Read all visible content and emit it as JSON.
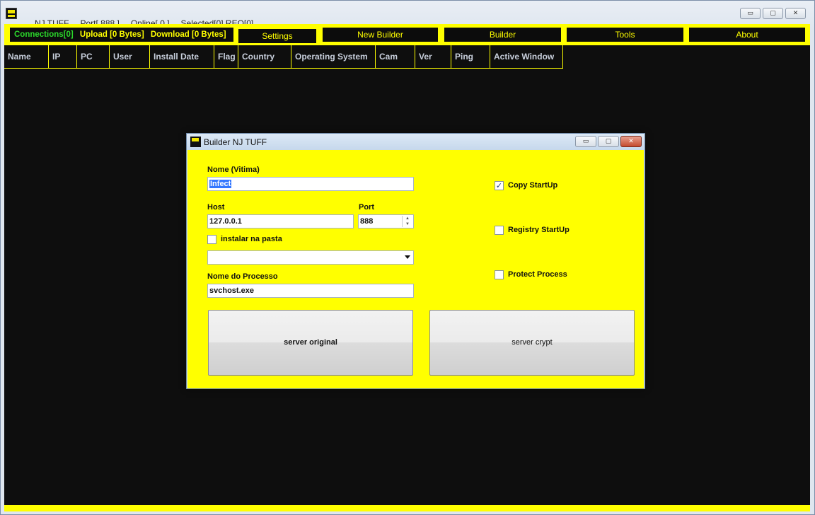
{
  "window": {
    "app_name": "NJ TUFF",
    "port": "Port[ 888 ]",
    "online": "Online[ 0 ]",
    "selected": "Selected[0] REQ[0]",
    "controls": {
      "minimize": "▭",
      "maximize": "▢",
      "close": "✕"
    }
  },
  "toolbar": {
    "connections": "Connections[0]",
    "upload": "Upload [0 Bytes]",
    "download": "Download [0 Bytes]",
    "buttons": [
      "Settings",
      "New Builder",
      "Builder",
      "Tools",
      "About"
    ],
    "colors": {
      "bar": "#ffff00",
      "button_bg": "#0c0c0c",
      "connections_text": "#2bd62b"
    }
  },
  "table": {
    "columns": [
      "Name",
      "IP",
      "PC",
      "User",
      "Install Date",
      "Flag",
      "Country",
      "Operating System",
      "Cam",
      "Ver",
      "Ping",
      "Active Window"
    ],
    "rows": []
  },
  "dialog": {
    "title": "Builder NJ TUFF",
    "nome_label": "Nome (Vitima)",
    "nome_value": "Infect",
    "host_label": "Host",
    "host_value": "127.0.0.1",
    "port_label": "Port",
    "port_value": "888",
    "instalar_label": "instalar na pasta",
    "instalar_checked": false,
    "folder_value": "",
    "processo_label": "Nome do Processo",
    "processo_value": "svchost.exe",
    "copy_startup_label": "Copy StartUp",
    "copy_startup_checked": true,
    "registry_startup_label": "Registry StartUp",
    "registry_startup_checked": false,
    "protect_process_label": "Protect Process",
    "protect_process_checked": false,
    "server_original": "server original",
    "server_crypt": "server crypt"
  }
}
